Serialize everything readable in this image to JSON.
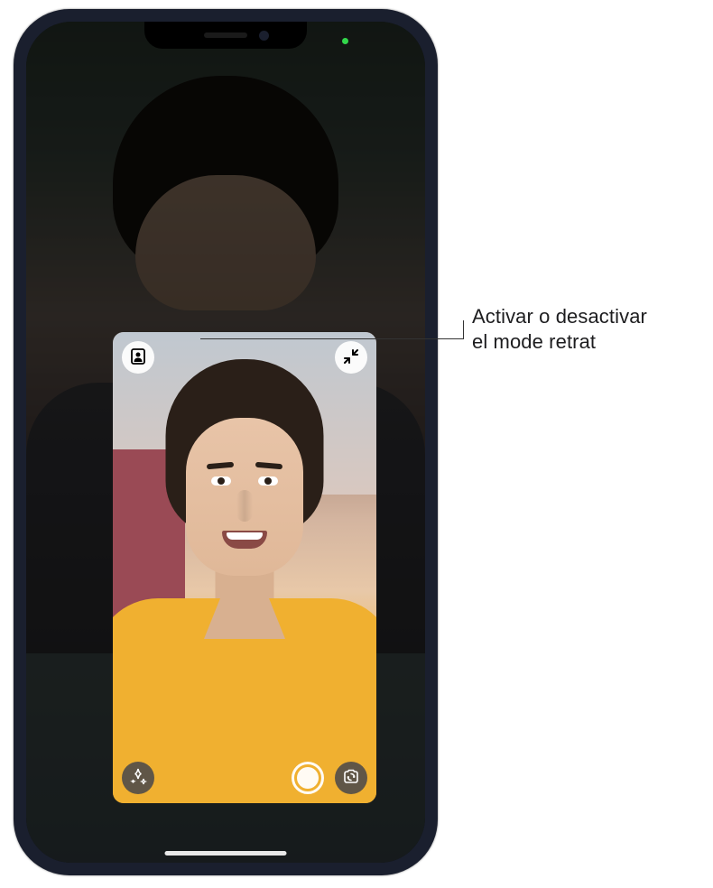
{
  "callout": {
    "text_line1": "Activar o desactivar",
    "text_line2": "el mode retrat"
  },
  "buttons": {
    "portrait_mode": "portrait-mode",
    "minimize": "minimize",
    "effects": "effects",
    "shutter": "shutter",
    "flip_camera": "flip-camera"
  }
}
